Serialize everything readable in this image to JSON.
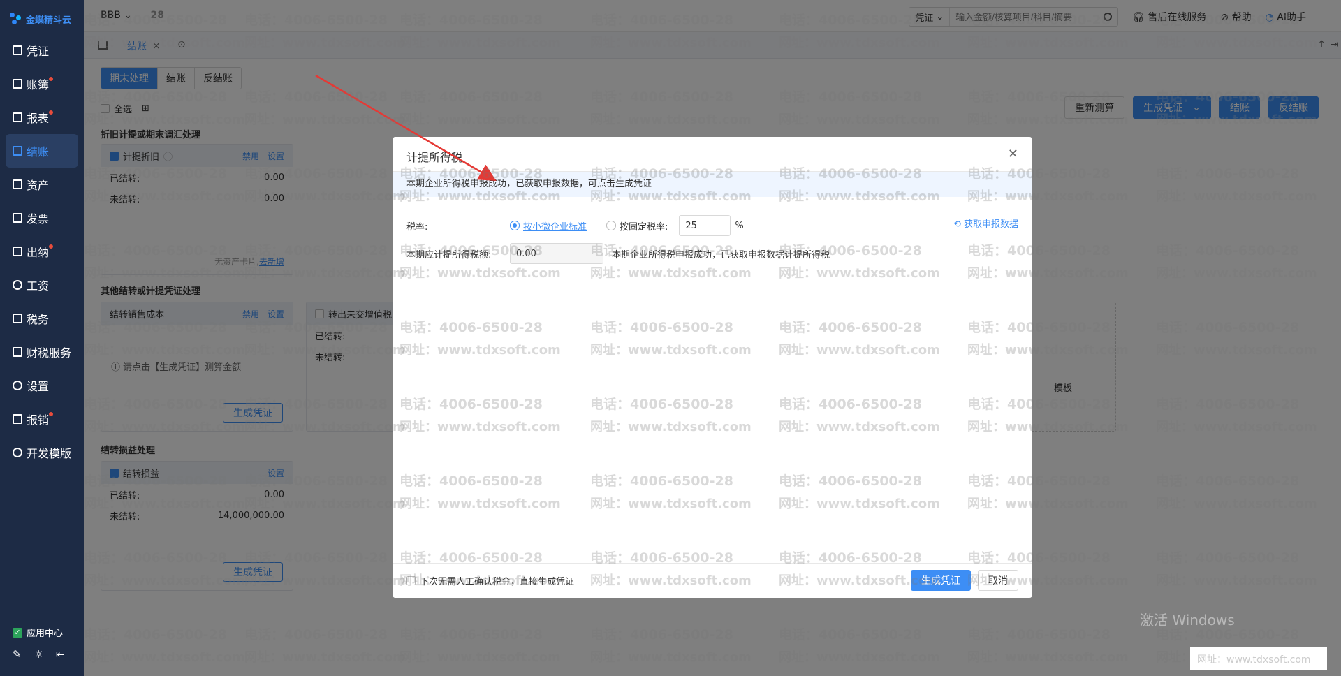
{
  "app": {
    "logo_text": "金蝶精斗云",
    "account": "BBB",
    "account_sub": "28"
  },
  "sidebar": {
    "items": [
      {
        "label": "凭证",
        "dot": false
      },
      {
        "label": "账簿",
        "dot": true
      },
      {
        "label": "报表",
        "dot": true
      },
      {
        "label": "结账",
        "dot": false,
        "active": true
      },
      {
        "label": "资产",
        "dot": false
      },
      {
        "label": "发票",
        "dot": false
      },
      {
        "label": "出纳",
        "dot": true
      },
      {
        "label": "工资",
        "dot": false
      },
      {
        "label": "税务",
        "dot": false
      },
      {
        "label": "财税服务",
        "dot": false
      },
      {
        "label": "设置",
        "dot": false
      },
      {
        "label": "报销",
        "dot": true
      },
      {
        "label": "开发模版",
        "dot": false
      }
    ],
    "app_center": "应用中心"
  },
  "topbar": {
    "search_type": "凭证",
    "search_placeholder": "输入金额/核算项目/科目/摘要",
    "service": "售后在线服务",
    "help": "帮助",
    "ai": "AI助手"
  },
  "tabs": {
    "current": "结账"
  },
  "main": {
    "segments": [
      "期末处理",
      "结账",
      "反结账"
    ],
    "select_all": "全选",
    "buttons": {
      "recalc": "重新测算",
      "gen": "生成凭证",
      "close": "结账",
      "unclose": "反结账"
    },
    "sections": {
      "s1": "折旧计提或期末调汇处理",
      "s2": "其他结转或计提凭证处理",
      "s3": "结转损益处理"
    },
    "card_depr": {
      "title": "计提折旧",
      "disable": "禁用",
      "settings": "设置",
      "done_label": "已结转:",
      "done": "0.00",
      "todo_label": "未结转:",
      "todo": "0.00",
      "note": "无资产卡片,",
      "note_link": "去新增"
    },
    "card_cost": {
      "title": "结转销售成本",
      "disable": "禁用",
      "settings": "设置",
      "hint": "请点击【生成凭证】测算金额",
      "gen": "生成凭证"
    },
    "card_vat": {
      "title": "转出未交增值税",
      "done_label": "已结转:",
      "todo_label": "未结转:"
    },
    "card_pl": {
      "title": "结转损益",
      "settings": "设置",
      "done_label": "已结转:",
      "done": "0.00",
      "todo_label": "未结转:",
      "todo": "14,000,000.00",
      "gen": "生成凭证"
    },
    "template_hint": "模板"
  },
  "dialog": {
    "title": "计提所得税",
    "info": "本期企业所得税申报成功，已获取申报数据，可点击生成凭证",
    "rate_label": "税率:",
    "opt_small": "按小微企业标准",
    "opt_fixed": "按固定税率:",
    "rate_value": "25",
    "percent": "%",
    "fetch": "获取申报数据",
    "amount_label": "本期应计提所得税额:",
    "amount_value": "0.00",
    "amount_note": "本期企业所得税申报成功，已获取申报数据计提所得税",
    "no_confirm": "下次无需人工确认税金，直接生成凭证",
    "gen": "生成凭证",
    "cancel": "取消"
  },
  "watermark": {
    "line1": "电话：4006-6500-28",
    "line2": "网址：www.tdxsoft.com"
  },
  "system": {
    "windows_activate": "激活 Windows"
  },
  "colors": {
    "accent": "#3d8ef5",
    "sidebar": "#1d2b45",
    "arrow": "#e53935"
  }
}
